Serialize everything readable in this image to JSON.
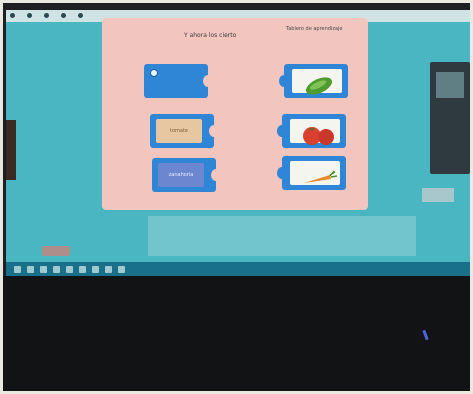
{
  "browser_tabs": [
    "",
    "",
    "",
    "",
    ""
  ],
  "activity": {
    "title": "Y ahora los cierto",
    "header_right": "Tablero de aprendizaje",
    "left_pieces": [
      {
        "label": ""
      },
      {
        "label": "tomate"
      },
      {
        "label": "zanahoria"
      }
    ],
    "right_pieces": [
      {
        "picture": "cucumber"
      },
      {
        "picture": "tomatoes"
      },
      {
        "picture": "carrot"
      }
    ],
    "status": ""
  },
  "footer_text": "",
  "colors": {
    "screen_bg": "#49b6c2",
    "panel_bg": "#f2c5bf",
    "piece_blue": "#2f86d6"
  }
}
